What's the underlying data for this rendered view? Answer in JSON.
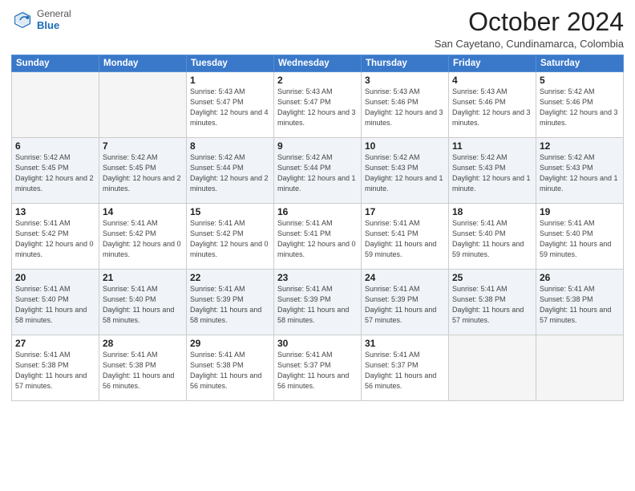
{
  "header": {
    "logo_general": "General",
    "logo_blue": "Blue",
    "month_title": "October 2024",
    "location": "San Cayetano, Cundinamarca, Colombia"
  },
  "days_of_week": [
    "Sunday",
    "Monday",
    "Tuesday",
    "Wednesday",
    "Thursday",
    "Friday",
    "Saturday"
  ],
  "weeks": [
    [
      {
        "day": "",
        "sunrise": "",
        "sunset": "",
        "daylight": ""
      },
      {
        "day": "",
        "sunrise": "",
        "sunset": "",
        "daylight": ""
      },
      {
        "day": "1",
        "sunrise": "Sunrise: 5:43 AM",
        "sunset": "Sunset: 5:47 PM",
        "daylight": "Daylight: 12 hours and 4 minutes."
      },
      {
        "day": "2",
        "sunrise": "Sunrise: 5:43 AM",
        "sunset": "Sunset: 5:47 PM",
        "daylight": "Daylight: 12 hours and 3 minutes."
      },
      {
        "day": "3",
        "sunrise": "Sunrise: 5:43 AM",
        "sunset": "Sunset: 5:46 PM",
        "daylight": "Daylight: 12 hours and 3 minutes."
      },
      {
        "day": "4",
        "sunrise": "Sunrise: 5:43 AM",
        "sunset": "Sunset: 5:46 PM",
        "daylight": "Daylight: 12 hours and 3 minutes."
      },
      {
        "day": "5",
        "sunrise": "Sunrise: 5:42 AM",
        "sunset": "Sunset: 5:46 PM",
        "daylight": "Daylight: 12 hours and 3 minutes."
      }
    ],
    [
      {
        "day": "6",
        "sunrise": "Sunrise: 5:42 AM",
        "sunset": "Sunset: 5:45 PM",
        "daylight": "Daylight: 12 hours and 2 minutes."
      },
      {
        "day": "7",
        "sunrise": "Sunrise: 5:42 AM",
        "sunset": "Sunset: 5:45 PM",
        "daylight": "Daylight: 12 hours and 2 minutes."
      },
      {
        "day": "8",
        "sunrise": "Sunrise: 5:42 AM",
        "sunset": "Sunset: 5:44 PM",
        "daylight": "Daylight: 12 hours and 2 minutes."
      },
      {
        "day": "9",
        "sunrise": "Sunrise: 5:42 AM",
        "sunset": "Sunset: 5:44 PM",
        "daylight": "Daylight: 12 hours and 1 minute."
      },
      {
        "day": "10",
        "sunrise": "Sunrise: 5:42 AM",
        "sunset": "Sunset: 5:43 PM",
        "daylight": "Daylight: 12 hours and 1 minute."
      },
      {
        "day": "11",
        "sunrise": "Sunrise: 5:42 AM",
        "sunset": "Sunset: 5:43 PM",
        "daylight": "Daylight: 12 hours and 1 minute."
      },
      {
        "day": "12",
        "sunrise": "Sunrise: 5:42 AM",
        "sunset": "Sunset: 5:43 PM",
        "daylight": "Daylight: 12 hours and 1 minute."
      }
    ],
    [
      {
        "day": "13",
        "sunrise": "Sunrise: 5:41 AM",
        "sunset": "Sunset: 5:42 PM",
        "daylight": "Daylight: 12 hours and 0 minutes."
      },
      {
        "day": "14",
        "sunrise": "Sunrise: 5:41 AM",
        "sunset": "Sunset: 5:42 PM",
        "daylight": "Daylight: 12 hours and 0 minutes."
      },
      {
        "day": "15",
        "sunrise": "Sunrise: 5:41 AM",
        "sunset": "Sunset: 5:42 PM",
        "daylight": "Daylight: 12 hours and 0 minutes."
      },
      {
        "day": "16",
        "sunrise": "Sunrise: 5:41 AM",
        "sunset": "Sunset: 5:41 PM",
        "daylight": "Daylight: 12 hours and 0 minutes."
      },
      {
        "day": "17",
        "sunrise": "Sunrise: 5:41 AM",
        "sunset": "Sunset: 5:41 PM",
        "daylight": "Daylight: 11 hours and 59 minutes."
      },
      {
        "day": "18",
        "sunrise": "Sunrise: 5:41 AM",
        "sunset": "Sunset: 5:40 PM",
        "daylight": "Daylight: 11 hours and 59 minutes."
      },
      {
        "day": "19",
        "sunrise": "Sunrise: 5:41 AM",
        "sunset": "Sunset: 5:40 PM",
        "daylight": "Daylight: 11 hours and 59 minutes."
      }
    ],
    [
      {
        "day": "20",
        "sunrise": "Sunrise: 5:41 AM",
        "sunset": "Sunset: 5:40 PM",
        "daylight": "Daylight: 11 hours and 58 minutes."
      },
      {
        "day": "21",
        "sunrise": "Sunrise: 5:41 AM",
        "sunset": "Sunset: 5:40 PM",
        "daylight": "Daylight: 11 hours and 58 minutes."
      },
      {
        "day": "22",
        "sunrise": "Sunrise: 5:41 AM",
        "sunset": "Sunset: 5:39 PM",
        "daylight": "Daylight: 11 hours and 58 minutes."
      },
      {
        "day": "23",
        "sunrise": "Sunrise: 5:41 AM",
        "sunset": "Sunset: 5:39 PM",
        "daylight": "Daylight: 11 hours and 58 minutes."
      },
      {
        "day": "24",
        "sunrise": "Sunrise: 5:41 AM",
        "sunset": "Sunset: 5:39 PM",
        "daylight": "Daylight: 11 hours and 57 minutes."
      },
      {
        "day": "25",
        "sunrise": "Sunrise: 5:41 AM",
        "sunset": "Sunset: 5:38 PM",
        "daylight": "Daylight: 11 hours and 57 minutes."
      },
      {
        "day": "26",
        "sunrise": "Sunrise: 5:41 AM",
        "sunset": "Sunset: 5:38 PM",
        "daylight": "Daylight: 11 hours and 57 minutes."
      }
    ],
    [
      {
        "day": "27",
        "sunrise": "Sunrise: 5:41 AM",
        "sunset": "Sunset: 5:38 PM",
        "daylight": "Daylight: 11 hours and 57 minutes."
      },
      {
        "day": "28",
        "sunrise": "Sunrise: 5:41 AM",
        "sunset": "Sunset: 5:38 PM",
        "daylight": "Daylight: 11 hours and 56 minutes."
      },
      {
        "day": "29",
        "sunrise": "Sunrise: 5:41 AM",
        "sunset": "Sunset: 5:38 PM",
        "daylight": "Daylight: 11 hours and 56 minutes."
      },
      {
        "day": "30",
        "sunrise": "Sunrise: 5:41 AM",
        "sunset": "Sunset: 5:37 PM",
        "daylight": "Daylight: 11 hours and 56 minutes."
      },
      {
        "day": "31",
        "sunrise": "Sunrise: 5:41 AM",
        "sunset": "Sunset: 5:37 PM",
        "daylight": "Daylight: 11 hours and 56 minutes."
      },
      {
        "day": "",
        "sunrise": "",
        "sunset": "",
        "daylight": ""
      },
      {
        "day": "",
        "sunrise": "",
        "sunset": "",
        "daylight": ""
      }
    ]
  ]
}
